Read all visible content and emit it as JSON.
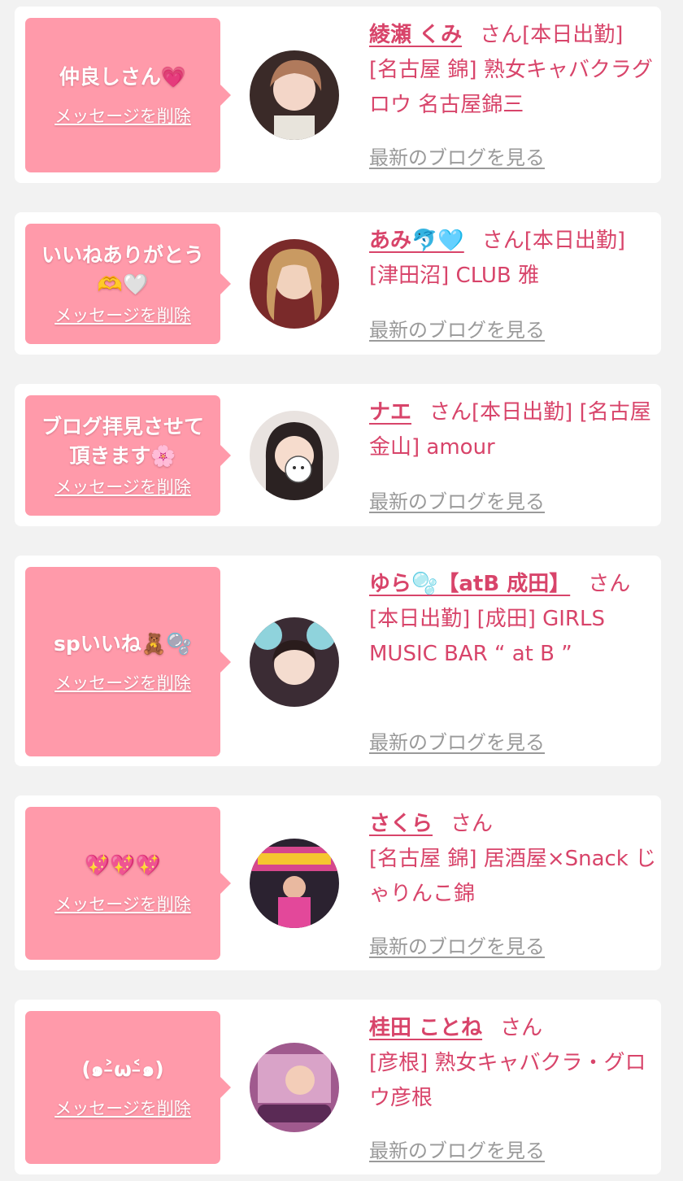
{
  "delete_label": "メッセージを削除",
  "blog_label": "最新のブログを見る",
  "san_suffix": "さん",
  "cards": [
    {
      "message": "仲良しさん💗",
      "name": "綾瀬 くみ",
      "attendance": "[本日出勤]",
      "shop": "[名古屋 錦] 熟女キャバクラグロウ 名古屋錦三"
    },
    {
      "message": "いいねありがとう\n🫶🤍",
      "name": "あみ🐬🩵",
      "attendance": "[本日出勤]",
      "shop": "[津田沼] CLUB 雅"
    },
    {
      "message": "ブログ拝見させて\n頂きます🌸",
      "name": "ナエ",
      "attendance": "[本日出勤]",
      "shop": "[名古屋 金山] amour"
    },
    {
      "message": "spいいね🧸🫧",
      "name": "ゆら🫧【atB 成田】",
      "attendance": "[本日出勤]",
      "shop": "[成田] GIRLS MUSIC BAR “ at B ”"
    },
    {
      "message": "💖💖💖",
      "name": "さくら",
      "attendance": "",
      "shop": "[名古屋 錦] 居酒屋×Snack じゃりんこ錦"
    },
    {
      "message": "(๑˃̵ω˂̵๑)",
      "name": "桂田 ことね",
      "attendance": "",
      "shop": "[彦根] 熟女キャバクラ・グロウ彦根"
    }
  ]
}
